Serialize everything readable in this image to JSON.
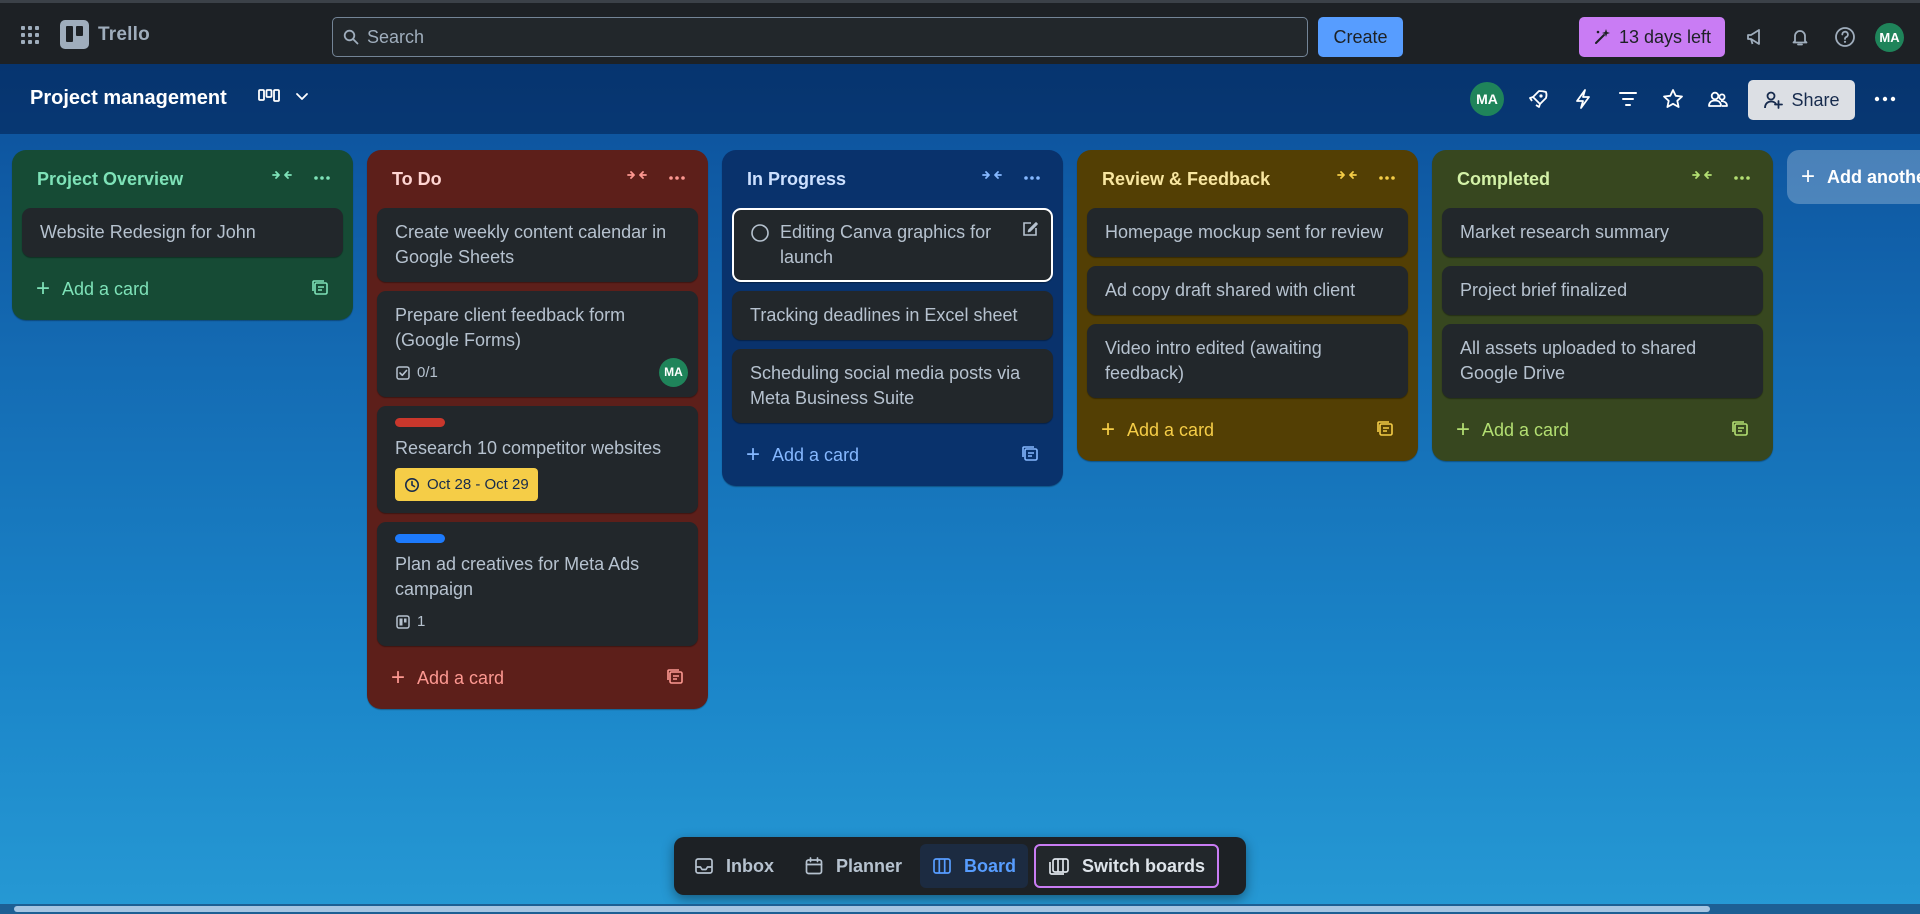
{
  "app": {
    "name": "Trello"
  },
  "header": {
    "search_placeholder": "Search",
    "create_label": "Create",
    "trial_label": "13 days left",
    "user_initials": "MA"
  },
  "board": {
    "title": "Project management",
    "member_initials": "MA",
    "share_label": "Share"
  },
  "lists": [
    {
      "title": "Project Overview",
      "cards": [
        {
          "text": "Website Redesign for John"
        }
      ],
      "add_label": "Add a card"
    },
    {
      "title": "To Do",
      "cards": [
        {
          "text": "Create weekly content calendar in Google Sheets"
        },
        {
          "text": "Prepare client feedback form (Google Forms)",
          "checklist": "0/1",
          "member": "MA"
        },
        {
          "text": "Research 10 competitor websites",
          "label_color": "#c9372c",
          "dates": "Oct 28 - Oct 29"
        },
        {
          "text": "Plan ad creatives for Meta Ads campaign",
          "label_color": "#1d7afc",
          "attachments": "1"
        }
      ],
      "add_label": "Add a card"
    },
    {
      "title": "In Progress",
      "cards": [
        {
          "text": "Editing Canva graphics for launch"
        },
        {
          "text": "Tracking deadlines in Excel sheet"
        },
        {
          "text": "Scheduling social media posts via Meta Business Suite"
        }
      ],
      "add_label": "Add a card"
    },
    {
      "title": "Review & Feedback",
      "cards": [
        {
          "text": "Homepage mockup sent for review"
        },
        {
          "text": "Ad copy draft shared with client"
        },
        {
          "text": "Video intro edited (awaiting feedback)"
        }
      ],
      "add_label": "Add a card"
    },
    {
      "title": "Completed",
      "cards": [
        {
          "text": "Market research summary"
        },
        {
          "text": "Project brief finalized"
        },
        {
          "text": "All assets uploaded to shared Google Drive"
        }
      ],
      "add_label": "Add a card"
    }
  ],
  "add_list_label": "Add another list",
  "dock": {
    "inbox": "Inbox",
    "planner": "Planner",
    "board": "Board",
    "switch": "Switch boards"
  },
  "colors": {
    "list_overview_bg": "#164b35",
    "list_todo_bg": "#5d1f1a",
    "list_progress_bg": "#09326c",
    "list_review_bg": "#533f04",
    "list_completed_bg": "#37471f"
  }
}
